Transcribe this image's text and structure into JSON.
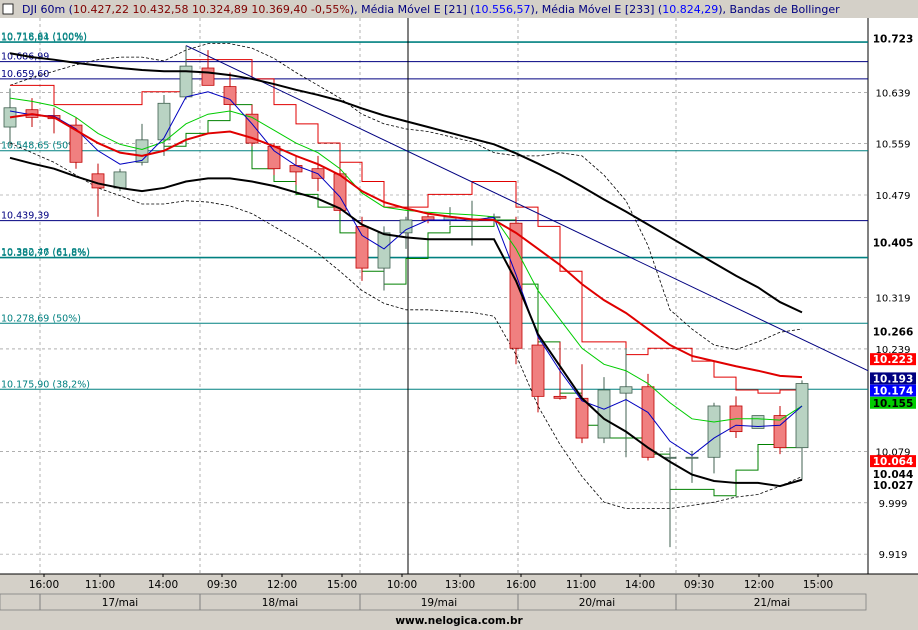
{
  "header": {
    "symbol": "DJI 60m",
    "ohlc": [
      "10.427,22",
      "10.432,58",
      "10.324,89",
      "10.369,40",
      "-0,55%"
    ],
    "indicators": [
      {
        "label": "Média Móvel E [21]",
        "value": "10.556,57",
        "color": "#000080"
      },
      {
        "label": "Média Móvel E [233]",
        "value": "10.824,29",
        "color": "#000080"
      },
      {
        "label": "Bandas de Bollinger",
        "value": "",
        "color": "#000080"
      }
    ]
  },
  "footer": {
    "watermark": "www.nelogica.com.br"
  },
  "chart_data": {
    "type": "candlestick",
    "y_ticks": [
      "10.639",
      "10.559",
      "10.479",
      "10.319",
      "10.239",
      "10.079",
      "9.999",
      "9.919"
    ],
    "x_ticks": [
      "16:00",
      "11:00",
      "14:00",
      "09:30",
      "12:00",
      "15:00",
      "10:00",
      "13:00",
      "16:00",
      "11:00",
      "14:00",
      "09:30",
      "12:00",
      "15:00"
    ],
    "date_labels": [
      "17/mai",
      "18/mai",
      "19/mai",
      "20/mai",
      "21/mai"
    ],
    "ylim": [
      9.888,
      10.755
    ],
    "candles": [
      {
        "o": 10.585,
        "h": 10.645,
        "l": 10.555,
        "c": 10.615
      },
      {
        "o": 10.612,
        "h": 10.63,
        "l": 10.585,
        "c": 10.6
      },
      {
        "o": 10.603,
        "h": 10.615,
        "l": 10.575,
        "c": 10.598
      },
      {
        "o": 10.588,
        "h": 10.6,
        "l": 10.52,
        "c": 10.53
      },
      {
        "o": 10.512,
        "h": 10.528,
        "l": 10.445,
        "c": 10.49
      },
      {
        "o": 10.49,
        "h": 10.52,
        "l": 10.485,
        "c": 10.515
      },
      {
        "o": 10.53,
        "h": 10.59,
        "l": 10.525,
        "c": 10.565
      },
      {
        "o": 10.565,
        "h": 10.635,
        "l": 10.54,
        "c": 10.622
      },
      {
        "o": 10.632,
        "h": 10.712,
        "l": 10.628,
        "c": 10.68
      },
      {
        "o": 10.677,
        "h": 10.705,
        "l": 10.65,
        "c": 10.65
      },
      {
        "o": 10.648,
        "h": 10.67,
        "l": 10.61,
        "c": 10.62
      },
      {
        "o": 10.605,
        "h": 10.62,
        "l": 10.555,
        "c": 10.56
      },
      {
        "o": 10.555,
        "h": 10.56,
        "l": 10.51,
        "c": 10.52
      },
      {
        "o": 10.525,
        "h": 10.54,
        "l": 10.495,
        "c": 10.515
      },
      {
        "o": 10.52,
        "h": 10.54,
        "l": 10.485,
        "c": 10.505
      },
      {
        "o": 10.512,
        "h": 10.54,
        "l": 10.45,
        "c": 10.455
      },
      {
        "o": 10.43,
        "h": 10.445,
        "l": 10.345,
        "c": 10.365
      },
      {
        "o": 10.365,
        "h": 10.43,
        "l": 10.33,
        "c": 10.42
      },
      {
        "o": 10.42,
        "h": 10.445,
        "l": 10.395,
        "c": 10.44
      },
      {
        "o": 10.445,
        "h": 10.45,
        "l": 10.435,
        "c": 10.44
      },
      {
        "o": 10.44,
        "h": 10.46,
        "l": 10.432,
        "c": 10.445
      },
      {
        "o": 10.44,
        "h": 10.47,
        "l": 10.4,
        "c": 10.44
      },
      {
        "o": 10.445,
        "h": 10.45,
        "l": 10.435,
        "c": 10.445
      },
      {
        "o": 10.435,
        "h": 10.445,
        "l": 10.215,
        "c": 10.24
      },
      {
        "o": 10.245,
        "h": 10.26,
        "l": 10.14,
        "c": 10.165
      },
      {
        "o": 10.165,
        "h": 10.25,
        "l": 10.16,
        "c": 10.162
      },
      {
        "o": 10.162,
        "h": 10.215,
        "l": 10.092,
        "c": 10.1
      },
      {
        "o": 10.1,
        "h": 10.195,
        "l": 10.092,
        "c": 10.175
      },
      {
        "o": 10.17,
        "h": 10.24,
        "l": 10.07,
        "c": 10.18
      },
      {
        "o": 10.18,
        "h": 10.2,
        "l": 10.065,
        "c": 10.07
      },
      {
        "o": 10.07,
        "h": 10.085,
        "l": 9.93,
        "c": 10.07
      },
      {
        "o": 10.07,
        "h": 10.08,
        "l": 10.03,
        "c": 10.07
      },
      {
        "o": 10.07,
        "h": 10.155,
        "l": 10.045,
        "c": 10.15
      },
      {
        "o": 10.15,
        "h": 10.165,
        "l": 10.1,
        "c": 10.11
      },
      {
        "o": 10.115,
        "h": 10.135,
        "l": 10.115,
        "c": 10.135
      },
      {
        "o": 10.135,
        "h": 10.15,
        "l": 10.075,
        "c": 10.085
      },
      {
        "o": 10.085,
        "h": 10.19,
        "l": 10.035,
        "c": 10.185
      }
    ],
    "mme21": [
      10.6,
      10.605,
      10.6,
      10.58,
      10.56,
      10.545,
      10.54,
      10.548,
      10.565,
      10.575,
      10.578,
      10.568,
      10.555,
      10.54,
      10.527,
      10.51,
      10.485,
      10.468,
      10.458,
      10.45,
      10.445,
      10.441,
      10.44,
      10.42,
      10.395,
      10.37,
      10.34,
      10.315,
      10.295,
      10.27,
      10.245,
      10.228,
      10.22,
      10.212,
      10.205,
      10.197,
      10.195
    ],
    "mme233": [
      10.7,
      10.694,
      10.69,
      10.685,
      10.681,
      10.677,
      10.674,
      10.672,
      10.672,
      10.67,
      10.666,
      10.66,
      10.652,
      10.643,
      10.635,
      10.626,
      10.614,
      10.603,
      10.594,
      10.585,
      10.576,
      10.567,
      10.558,
      10.544,
      10.528,
      10.511,
      10.492,
      10.472,
      10.453,
      10.433,
      10.413,
      10.393,
      10.373,
      10.353,
      10.335,
      10.312,
      10.296
    ],
    "ma_fast": [
      10.61,
      10.604,
      10.602,
      10.582,
      10.548,
      10.527,
      10.533,
      10.568,
      10.632,
      10.64,
      10.628,
      10.59,
      10.548,
      10.525,
      10.512,
      10.476,
      10.416,
      10.395,
      10.425,
      10.44,
      10.44,
      10.44,
      10.444,
      10.355,
      10.258,
      10.205,
      10.158,
      10.145,
      10.16,
      10.14,
      10.095,
      10.073,
      10.1,
      10.12,
      10.118,
      10.12,
      10.15
    ],
    "ma_green": [
      10.63,
      10.625,
      10.618,
      10.6,
      10.575,
      10.558,
      10.55,
      10.562,
      10.59,
      10.605,
      10.61,
      10.6,
      10.58,
      10.56,
      10.545,
      10.52,
      10.482,
      10.46,
      10.455,
      10.452,
      10.45,
      10.448,
      10.445,
      10.395,
      10.33,
      10.285,
      10.24,
      10.215,
      10.205,
      10.185,
      10.155,
      10.13,
      10.125,
      10.13,
      10.13,
      10.128,
      10.15
    ],
    "ma_black": [
      10.537,
      10.528,
      10.52,
      10.508,
      10.497,
      10.49,
      10.485,
      10.49,
      10.5,
      10.505,
      10.505,
      10.5,
      10.493,
      10.483,
      10.473,
      10.458,
      10.433,
      10.418,
      10.413,
      10.41,
      10.41,
      10.41,
      10.41,
      10.345,
      10.262,
      10.212,
      10.162,
      10.13,
      10.11,
      10.085,
      10.063,
      10.043,
      10.033,
      10.03,
      10.03,
      10.025,
      10.035
    ],
    "boll_upper": [
      10.65,
      10.662,
      10.672,
      10.682,
      10.69,
      10.694,
      10.694,
      10.688,
      10.705,
      10.715,
      10.715,
      10.708,
      10.692,
      10.67,
      10.65,
      10.63,
      10.605,
      10.59,
      10.582,
      10.578,
      10.57,
      10.562,
      10.545,
      10.54,
      10.54,
      10.545,
      10.54,
      10.51,
      10.47,
      10.4,
      10.3,
      10.27,
      10.245,
      10.238,
      10.25,
      10.265,
      10.27
    ],
    "boll_lower": [
      10.56,
      10.545,
      10.53,
      10.51,
      10.49,
      10.478,
      10.465,
      10.465,
      10.47,
      10.468,
      10.462,
      10.45,
      10.43,
      10.41,
      10.388,
      10.36,
      10.33,
      10.31,
      10.3,
      10.3,
      10.298,
      10.296,
      10.29,
      10.23,
      10.15,
      10.09,
      10.04,
      10.0,
      9.99,
      9.99,
      9.99,
      9.995,
      10.0,
      10.008,
      10.012,
      10.025,
      10.04
    ],
    "step_red": [
      10.65,
      10.65,
      10.62,
      10.62,
      10.62,
      10.62,
      10.64,
      10.64,
      10.69,
      10.69,
      10.69,
      10.66,
      10.62,
      10.59,
      10.56,
      10.53,
      10.5,
      10.46,
      10.46,
      10.48,
      10.48,
      10.5,
      10.5,
      10.46,
      10.43,
      10.36,
      10.25,
      10.25,
      10.23,
      10.24,
      10.24,
      10.22,
      10.195,
      10.175,
      10.17,
      10.175,
      10.175
    ],
    "step_green": [
      null,
      null,
      null,
      null,
      null,
      null,
      null,
      10.555,
      10.575,
      10.595,
      10.62,
      10.52,
      10.5,
      10.48,
      10.46,
      10.42,
      10.36,
      10.34,
      10.38,
      10.42,
      10.43,
      10.43,
      10.44,
      10.34,
      10.25,
      10.17,
      10.12,
      10.1,
      10.1,
      10.075,
      10.02,
      10.02,
      10.01,
      10.05,
      10.09,
      10.085,
      10.085
    ],
    "hlines": [
      {
        "y": 10.718,
        "label": "10.718,61 (100%)",
        "color": "#008080"
      },
      {
        "y": 10.717,
        "label": "10.716,84 (100%)",
        "color": "#008080"
      },
      {
        "y": 10.687,
        "label": "10.686,99",
        "color": "#000080"
      },
      {
        "y": 10.66,
        "label": "10.659,60",
        "color": "#000080"
      },
      {
        "y": 10.548,
        "label": "10.548,65 (50%)",
        "color": "#008080"
      },
      {
        "y": 10.439,
        "label": "10.439,39",
        "color": "#000080"
      },
      {
        "y": 10.382,
        "label": "10.382,46 (61,8%)",
        "color": "#008080"
      },
      {
        "y": 10.381,
        "label": "10.380,77 (61,8%)",
        "color": "#008080"
      },
      {
        "y": 10.279,
        "label": "10.278,69 (50%)",
        "color": "#008080"
      },
      {
        "y": 10.176,
        "label": "10.175,90 (38,2%)",
        "color": "#008080"
      }
    ],
    "trendline": {
      "from": [
        8,
        10.712
      ],
      "to": [
        37,
        10.205
      ]
    },
    "price_tags": [
      {
        "label": "10.723",
        "y": 10.723,
        "bg": "#ffffff",
        "fg": "#000000"
      },
      {
        "label": "10.405",
        "y": 10.405,
        "bg": "#ffffff",
        "fg": "#000000"
      },
      {
        "label": "10.266",
        "y": 10.266,
        "bg": "#ffffff",
        "fg": "#000000"
      },
      {
        "label": "10.223",
        "y": 10.223,
        "bg": "#ff0000",
        "fg": "#ffffff"
      },
      {
        "label": "10.193",
        "y": 10.193,
        "bg": "#000080",
        "fg": "#ffffff"
      },
      {
        "label": "10.174",
        "y": 10.174,
        "bg": "#0000ff",
        "fg": "#ffffff"
      },
      {
        "label": "10.155",
        "y": 10.155,
        "bg": "#00cc00",
        "fg": "#000000"
      },
      {
        "label": "10.064",
        "y": 10.064,
        "bg": "#ff0000",
        "fg": "#ffffff"
      },
      {
        "label": "10.044",
        "y": 10.044,
        "bg": "#ffffff",
        "fg": "#000000"
      },
      {
        "label": "10.027",
        "y": 10.027,
        "bg": "#ffffff",
        "fg": "#000000"
      }
    ],
    "colors": {
      "up": "#b9d3c3",
      "down": "#f08080",
      "mme21": "#e00000",
      "mme233": "#000000",
      "fast": "#0000c0",
      "green": "#00cc00",
      "black": "#000000",
      "boll": "#000000",
      "step_red": "#e00000",
      "step_green": "#008000",
      "grid": "#808080"
    }
  }
}
